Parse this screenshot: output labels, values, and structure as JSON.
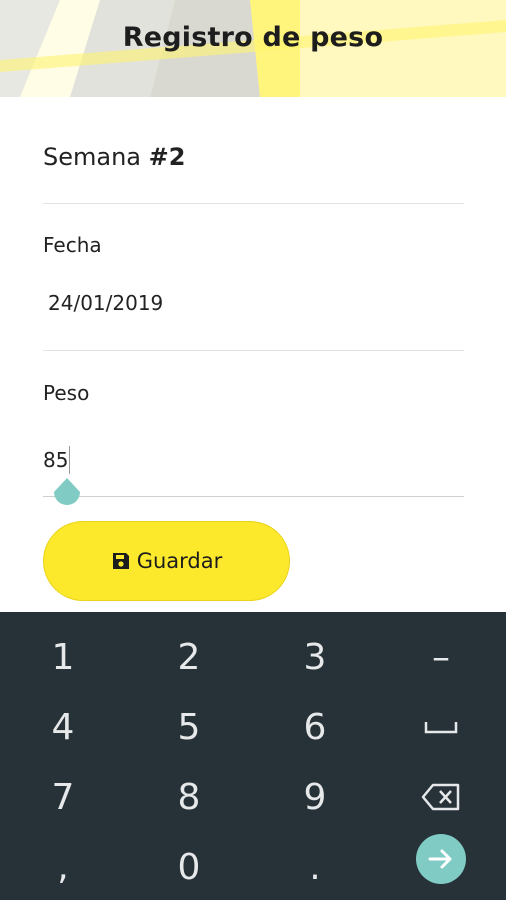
{
  "header": {
    "title": "Registro de peso"
  },
  "week": {
    "label": "Semana",
    "number": "#2"
  },
  "fecha": {
    "label": "Fecha",
    "value": "24/01/2019"
  },
  "peso": {
    "label": "Peso",
    "value": "85"
  },
  "save_button": {
    "label": "Guardar",
    "icon": "floppy-disk-icon"
  },
  "keyboard": {
    "rows": [
      [
        "1",
        "2",
        "3",
        "–"
      ],
      [
        "4",
        "5",
        "6",
        "␣"
      ],
      [
        "7",
        "8",
        "9",
        "⌫"
      ],
      [
        ",",
        "0",
        ".",
        "→"
      ]
    ]
  },
  "colors": {
    "header_bg": "#fff9c0",
    "accent_yellow": "#fde92b",
    "teal": "#80cbc4",
    "keyboard_bg": "#263238"
  }
}
